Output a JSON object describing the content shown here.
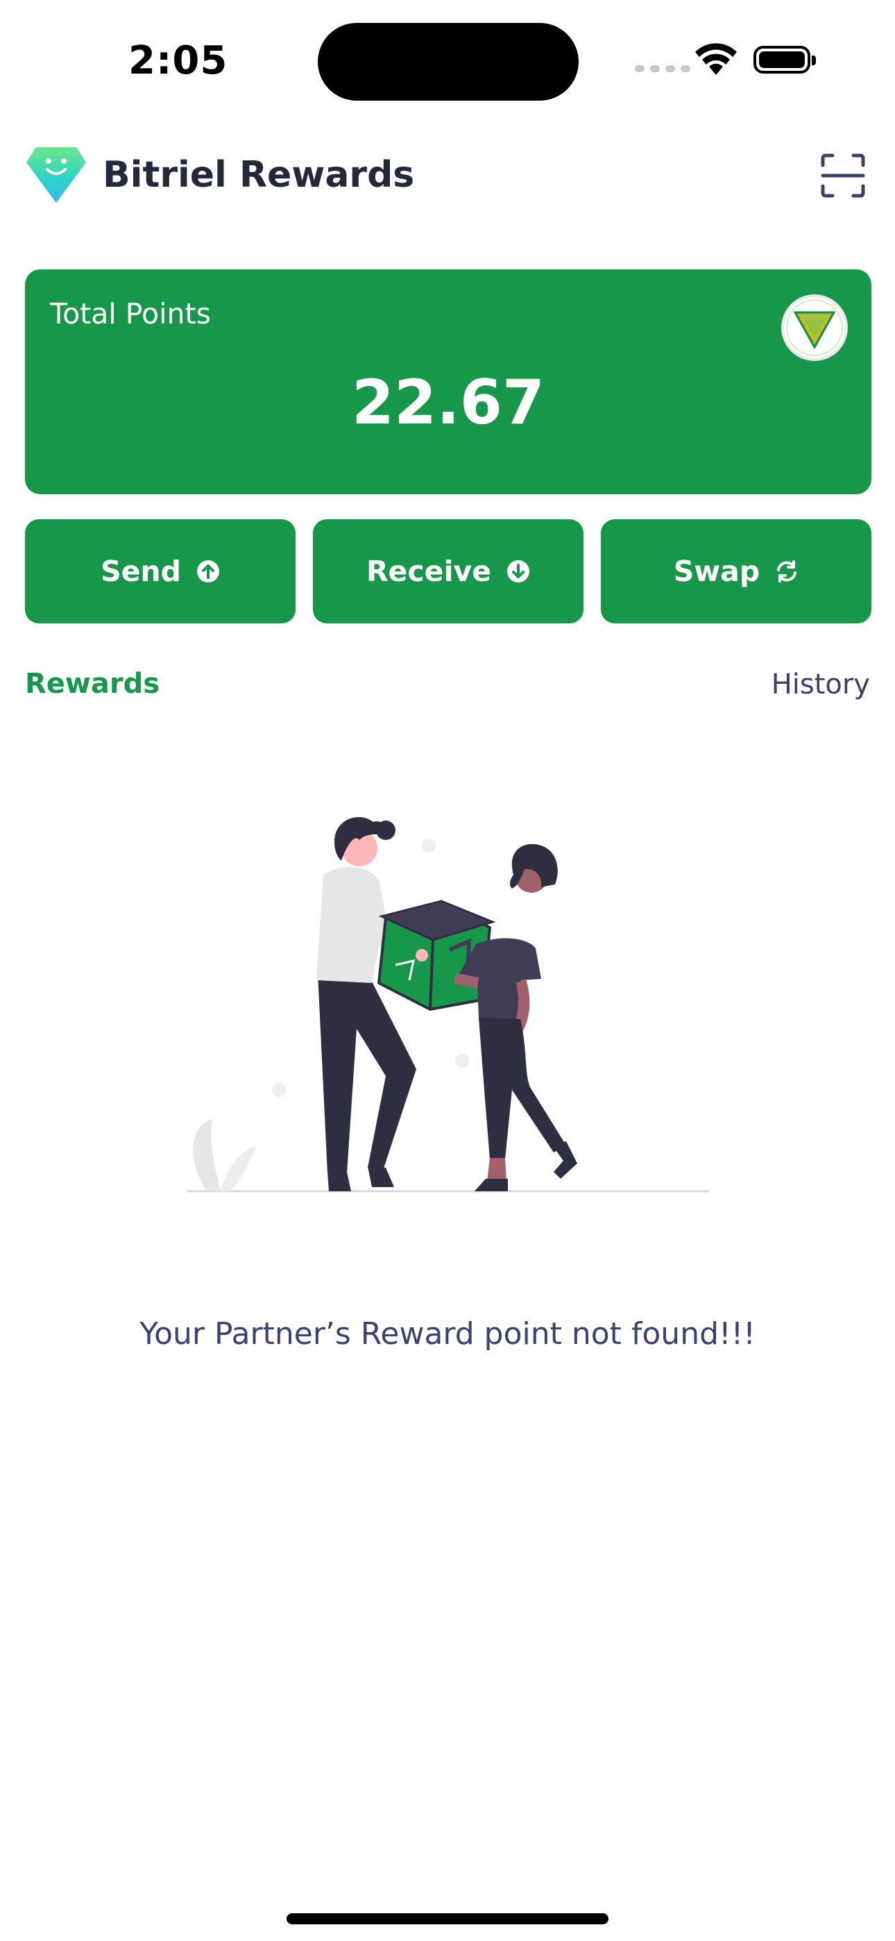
{
  "status_bar": {
    "time": "2:05"
  },
  "header": {
    "app_title": "Bitriel Rewards",
    "logo_icon": "diamond-logo-icon",
    "scan_icon": "scan-icon"
  },
  "points_card": {
    "label": "Total Points",
    "value": "22.67",
    "badge_icon": "smart-vip-icon",
    "background": "#17974a"
  },
  "actions": [
    {
      "label": "Send",
      "icon": "arrow-up-circle-icon"
    },
    {
      "label": "Receive",
      "icon": "arrow-down-circle-icon"
    },
    {
      "label": "Swap",
      "icon": "refresh-icon"
    }
  ],
  "tabs": {
    "rewards": "Rewards",
    "history": "History"
  },
  "empty_state": {
    "illustration": "gift-exchange-illustration",
    "message": "Your Partner’s Reward point not found!!!"
  },
  "colors": {
    "accent": "#17974a",
    "text_dark": "#23283a",
    "text_navy": "#3b4170"
  }
}
